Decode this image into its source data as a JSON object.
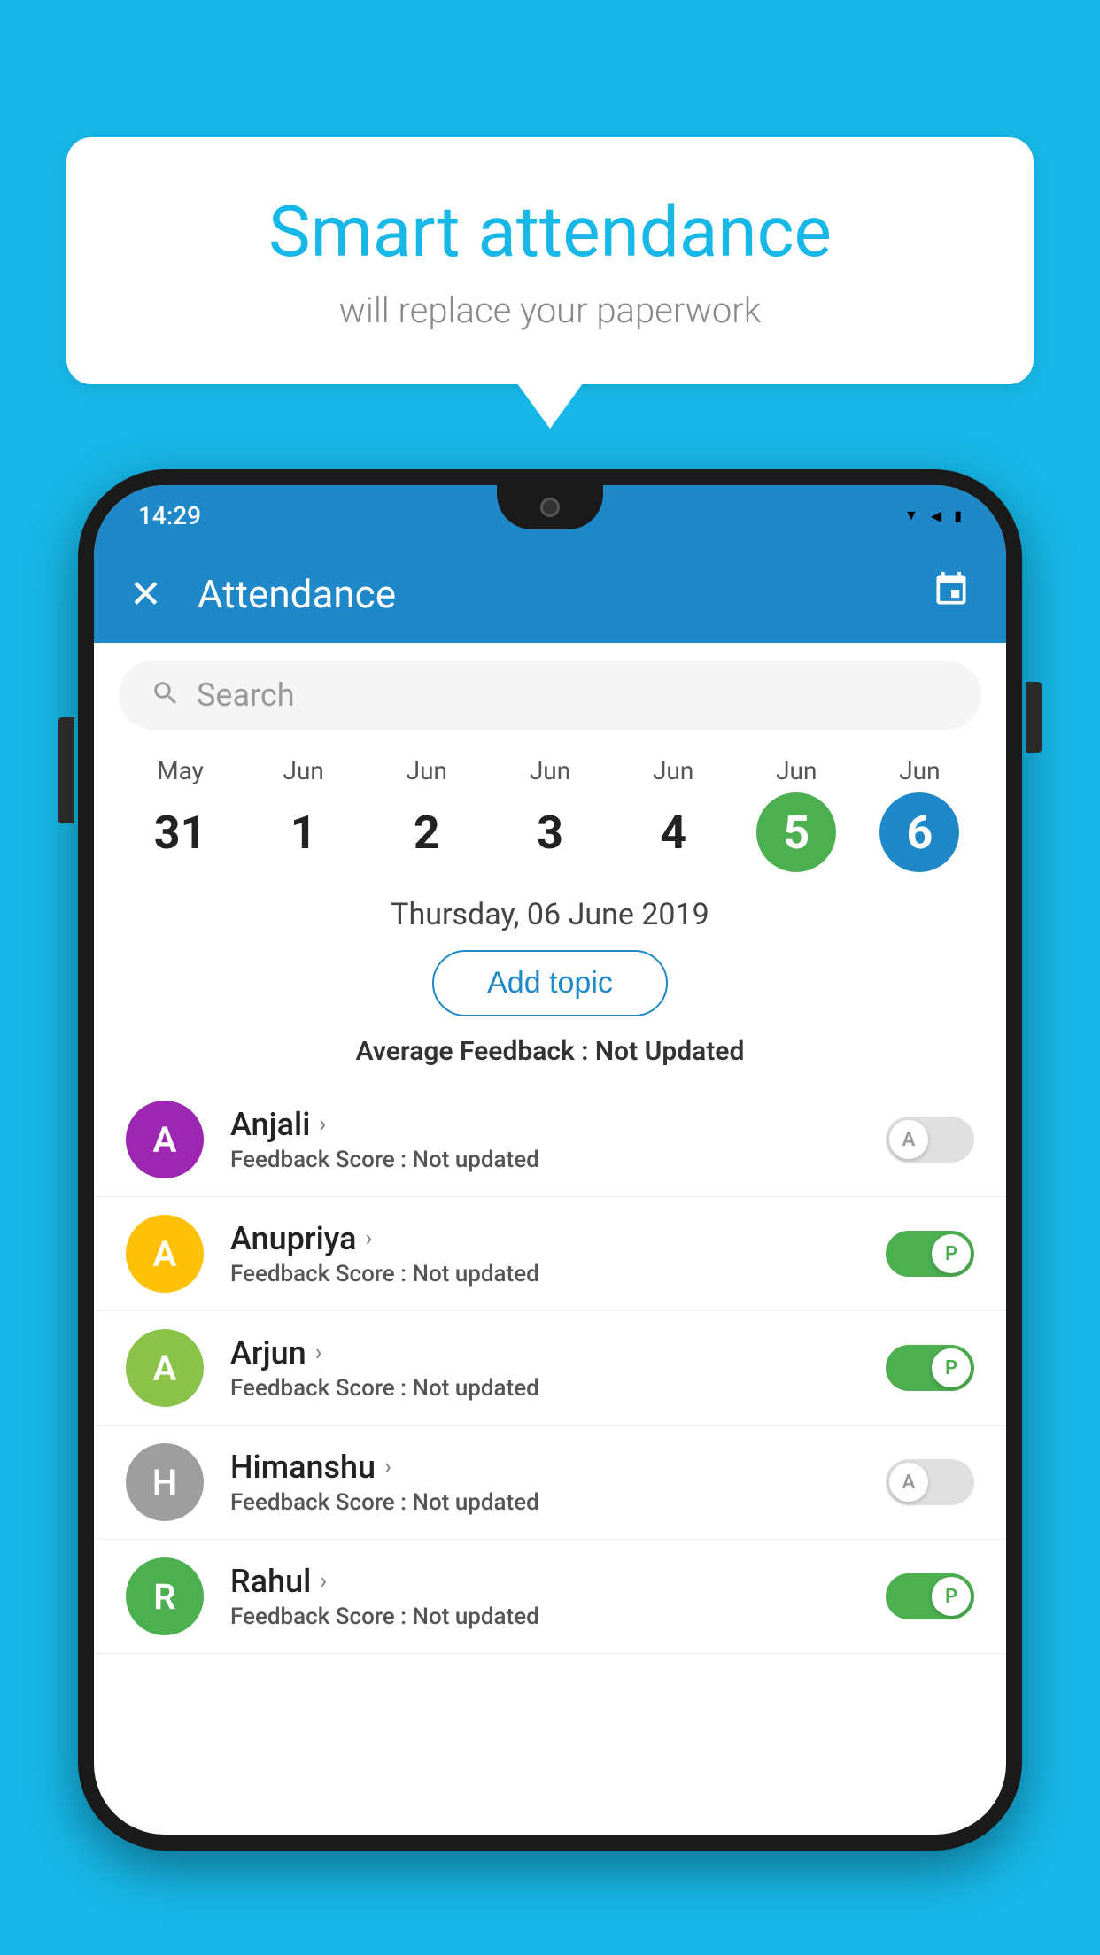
{
  "background_color": "#17B8E8",
  "bubble": {
    "title": "Smart attendance",
    "subtitle": "will replace your paperwork"
  },
  "status_bar": {
    "time": "14:29",
    "wifi": "▼",
    "signal": "▲",
    "battery": "▪"
  },
  "app_bar": {
    "title": "Attendance",
    "close_label": "✕",
    "calendar_label": "📅"
  },
  "search": {
    "placeholder": "Search"
  },
  "date_strip": {
    "items": [
      {
        "month": "May",
        "day": "31",
        "selected": "none"
      },
      {
        "month": "Jun",
        "day": "1",
        "selected": "none"
      },
      {
        "month": "Jun",
        "day": "2",
        "selected": "none"
      },
      {
        "month": "Jun",
        "day": "3",
        "selected": "none"
      },
      {
        "month": "Jun",
        "day": "4",
        "selected": "none"
      },
      {
        "month": "Jun",
        "day": "5",
        "selected": "green"
      },
      {
        "month": "Jun",
        "day": "6",
        "selected": "blue"
      }
    ]
  },
  "selected_date": "Thursday, 06 June 2019",
  "add_topic_label": "Add topic",
  "average_feedback_prefix": "Average Feedback : ",
  "average_feedback_value": "Not Updated",
  "students": [
    {
      "name": "Anjali",
      "avatar_letter": "A",
      "avatar_color": "#9C27B0",
      "feedback_label": "Feedback Score : ",
      "feedback_value": "Not updated",
      "toggle_state": "off",
      "toggle_letter": "A"
    },
    {
      "name": "Anupriya",
      "avatar_letter": "A",
      "avatar_color": "#FFC107",
      "feedback_label": "Feedback Score : ",
      "feedback_value": "Not updated",
      "toggle_state": "on",
      "toggle_letter": "P"
    },
    {
      "name": "Arjun",
      "avatar_letter": "A",
      "avatar_color": "#8BC34A",
      "feedback_label": "Feedback Score : ",
      "feedback_value": "Not updated",
      "toggle_state": "on",
      "toggle_letter": "P"
    },
    {
      "name": "Himanshu",
      "avatar_letter": "H",
      "avatar_color": "#9E9E9E",
      "feedback_label": "Feedback Score : ",
      "feedback_value": "Not updated",
      "toggle_state": "off",
      "toggle_letter": "A"
    },
    {
      "name": "Rahul",
      "avatar_letter": "R",
      "avatar_color": "#4CAF50",
      "feedback_label": "Feedback Score : ",
      "feedback_value": "Not updated",
      "toggle_state": "on",
      "toggle_letter": "P"
    }
  ]
}
